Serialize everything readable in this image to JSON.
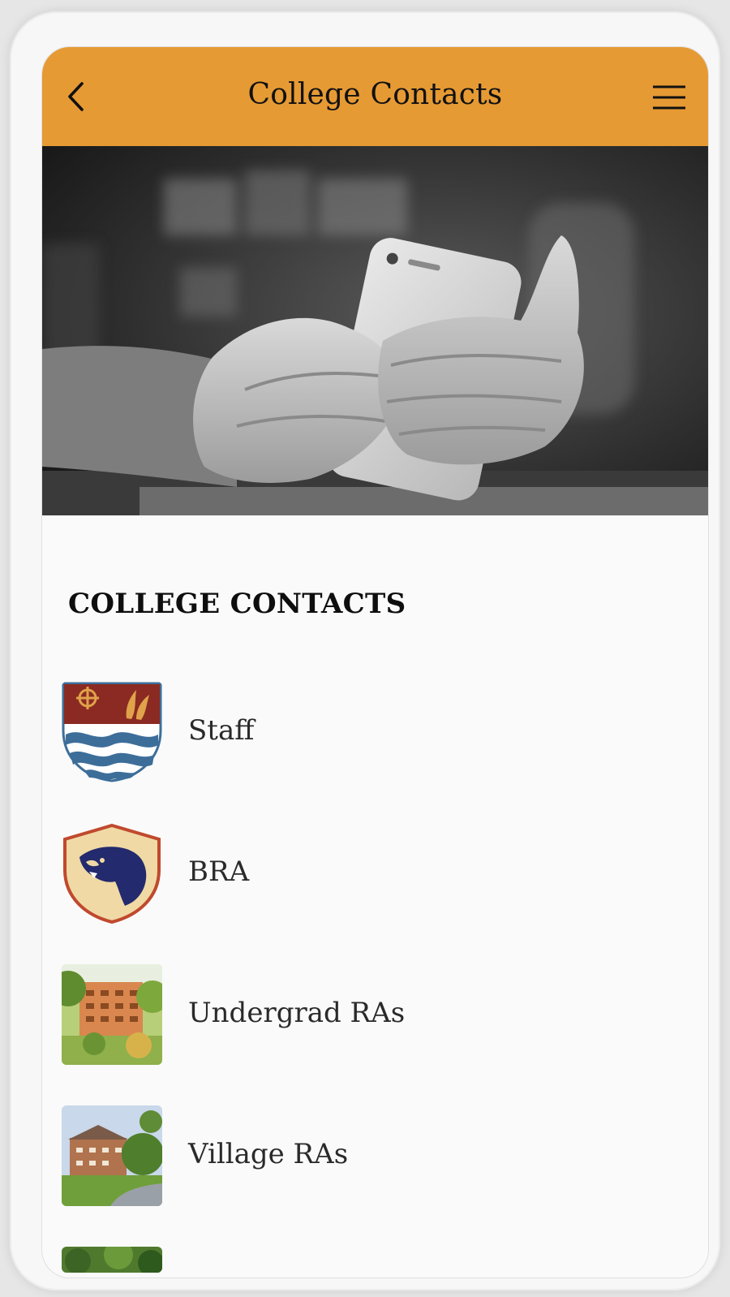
{
  "app": {
    "title": "College Contacts",
    "back_icon": "chevron-left-icon",
    "menu_icon": "hamburger-menu-icon",
    "accent_color": "#e69a34"
  },
  "hero": {
    "image": "hands-holding-smartphone-photo"
  },
  "section": {
    "heading": "COLLEGE CONTACTS"
  },
  "contacts": [
    {
      "label": "Staff",
      "thumbnail": "college-crest-shield"
    },
    {
      "label": "BRA",
      "thumbnail": "panther-shield-logo"
    },
    {
      "label": "Undergrad RAs",
      "thumbnail": "brick-residence-building-photo"
    },
    {
      "label": "Village RAs",
      "thumbnail": "village-residence-photo"
    },
    {
      "label": "",
      "thumbnail": "trees-photo"
    }
  ]
}
